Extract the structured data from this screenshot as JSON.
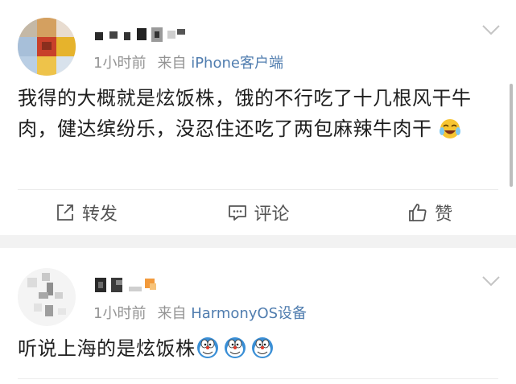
{
  "posts": [
    {
      "username": "",
      "time": "1小时前",
      "source_prefix": "来自",
      "source_client": "iPhone客户端",
      "content": "我得的大概就是炫饭株，饿的不行吃了十几根风干牛肉，健达缤纷乐，没忍住还吃了两包麻辣牛肉干",
      "emojis": [
        "laugh-cry-emoji"
      ],
      "actions": {
        "repost": "转发",
        "comment": "评论",
        "like": "赞"
      }
    },
    {
      "username": "",
      "time": "1小时前",
      "source_prefix": "来自",
      "source_client": "HarmonyOS设备",
      "content": "听说上海的是炫饭株",
      "emojis": [
        "doge-emoji",
        "doge-emoji",
        "doge-emoji"
      ]
    }
  ],
  "colors": {
    "client_link": "#507daf",
    "meta_gray": "#939393",
    "separator": "#f2f2f2"
  }
}
